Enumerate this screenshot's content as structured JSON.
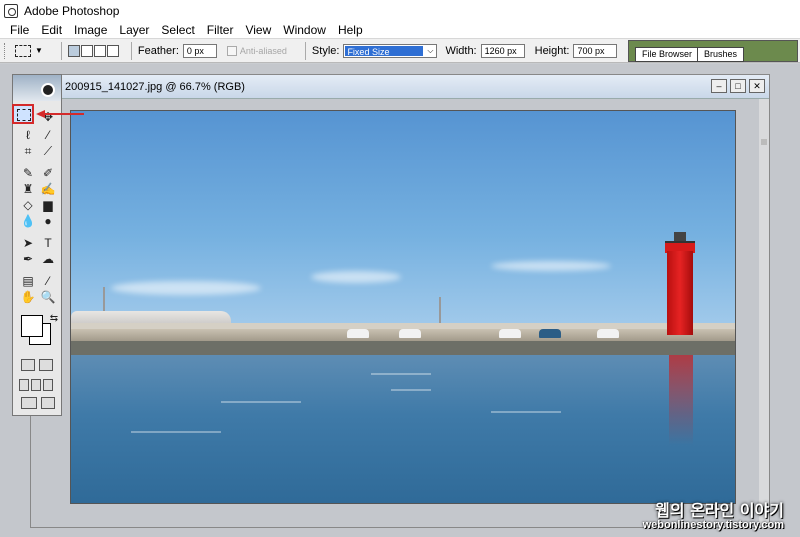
{
  "app": {
    "title": "Adobe Photoshop"
  },
  "menu": [
    "File",
    "Edit",
    "Image",
    "Layer",
    "Select",
    "Filter",
    "View",
    "Window",
    "Help"
  ],
  "options": {
    "feather_label": "Feather:",
    "feather_value": "0 px",
    "anti_aliased_label": "Anti-aliased",
    "style_label": "Style:",
    "style_value": "Fixed Size",
    "width_label": "Width:",
    "width_value": "1260 px",
    "height_label": "Height:",
    "height_value": "700 px"
  },
  "palette_well": {
    "tabs": [
      "File Browser",
      "Brushes"
    ]
  },
  "document": {
    "title": "200915_141027.jpg @ 66.7% (RGB)"
  },
  "toolbox": {
    "active_tool": "rectangular-marquee",
    "highlight_color": "#d42a2a"
  },
  "watermark": {
    "text": "웹의 온라인 이야기",
    "url": "webonlinestory.tistory.com"
  }
}
